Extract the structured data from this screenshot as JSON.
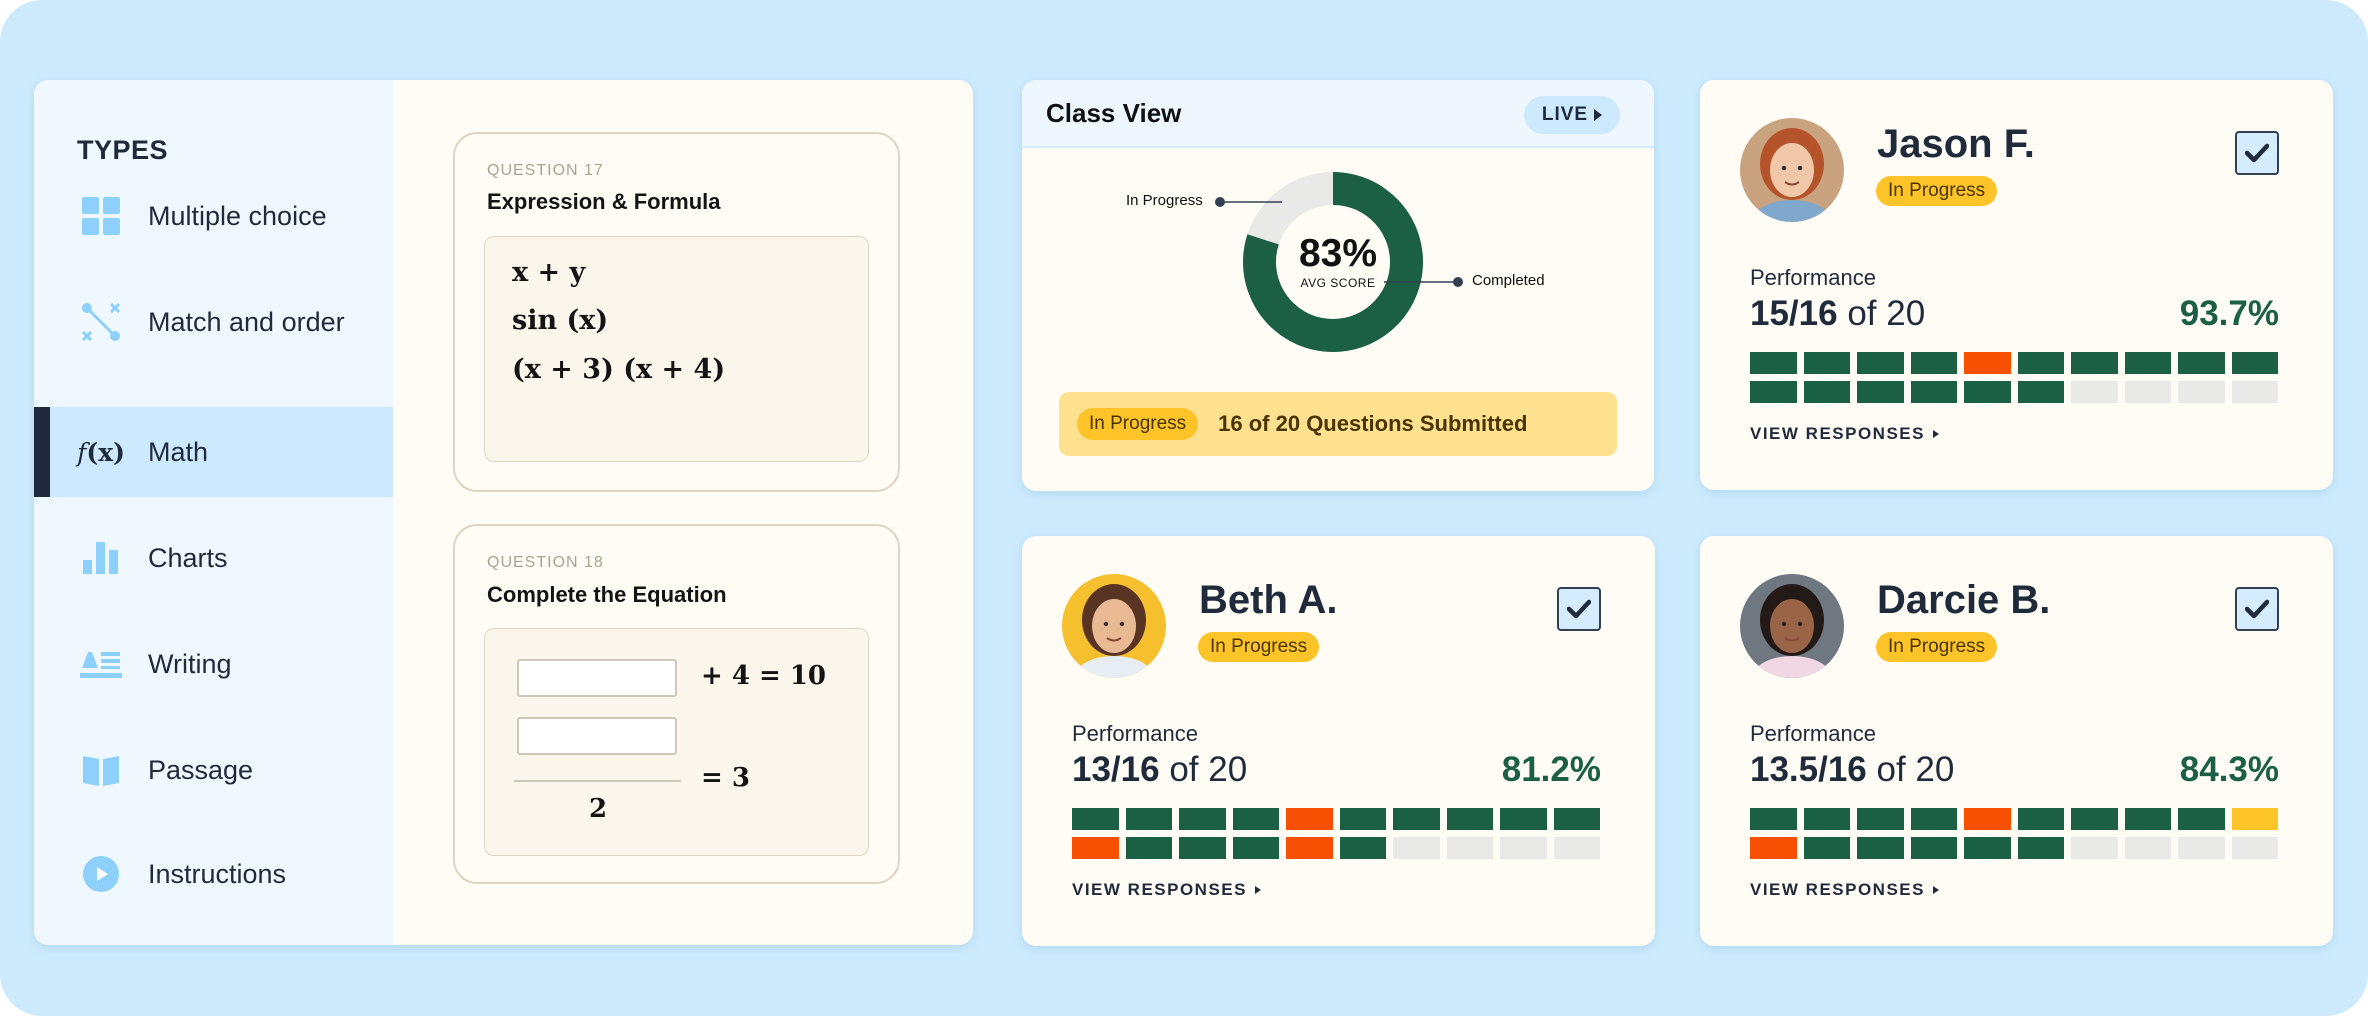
{
  "sidebar": {
    "title": "TYPES",
    "items": [
      {
        "label": "Multiple choice",
        "icon": "grid-icon",
        "active": false
      },
      {
        "label": "Match and order",
        "icon": "match-icon",
        "active": false
      },
      {
        "label": "Math",
        "icon": "fx-icon",
        "active": true
      },
      {
        "label": "Charts",
        "icon": "bar-chart-icon",
        "active": false
      },
      {
        "label": "Writing",
        "icon": "text-icon",
        "active": false
      },
      {
        "label": "Passage",
        "icon": "book-icon",
        "active": false
      },
      {
        "label": "Instructions",
        "icon": "play-icon",
        "active": false
      }
    ],
    "math_icon_f": "f",
    "math_icon_x": "(x)"
  },
  "questions": [
    {
      "number": "QUESTION 17",
      "title": "Expression & Formula",
      "lines": [
        "x + y",
        "sin (x)",
        "(x + 3) (x + 4)"
      ]
    },
    {
      "number": "QUESTION 18",
      "title": "Complete the Equation",
      "eq1_rhs": "+ 4 = 10",
      "eq2_rhs": "= 3",
      "eq2_denominator": "2",
      "input1_value": "",
      "input2_value": ""
    }
  ],
  "class_view": {
    "title": "Class View",
    "live_label": "LIVE",
    "status_pill": "In Progress",
    "status_text": "16 of 20 Questions Submitted",
    "donut": {
      "center_value": "83%",
      "center_label": "AVG SCORE",
      "segments": [
        {
          "name": "Completed",
          "fraction": 0.8,
          "color": "#1b6045"
        },
        {
          "name": "In Progress",
          "fraction": 0.2,
          "color": "#e9e9e7"
        }
      ]
    }
  },
  "students": [
    {
      "name": "Jason F.",
      "status": "In Progress",
      "checked": true,
      "performance_label": "Performance",
      "score": "15/16",
      "of_total": "of 20",
      "percent": "93.7%",
      "avatar_bg": "#c9a27f",
      "hair": "#b5532a",
      "skin": "#f0c7a8",
      "shirt": "#7fa8cc",
      "answers": [
        "c",
        "c",
        "c",
        "c",
        "w",
        "c",
        "c",
        "c",
        "c",
        "c",
        "c",
        "c",
        "c",
        "c",
        "c",
        "c",
        "e",
        "e",
        "e",
        "e"
      ],
      "view_label": "VIEW RESPONSES"
    },
    {
      "name": "Beth A.",
      "status": "In Progress",
      "checked": true,
      "performance_label": "Performance",
      "score": "13/16",
      "of_total": "of 20",
      "percent": "81.2%",
      "avatar_bg": "#f6bf2e",
      "hair": "#5a3422",
      "skin": "#e9b993",
      "shirt": "#e7eef3",
      "answers": [
        "c",
        "c",
        "c",
        "c",
        "w",
        "c",
        "c",
        "c",
        "c",
        "c",
        "w",
        "c",
        "c",
        "c",
        "w",
        "c",
        "e",
        "e",
        "e",
        "e"
      ],
      "view_label": "VIEW RESPONSES"
    },
    {
      "name": "Darcie B.",
      "status": "In Progress",
      "checked": true,
      "performance_label": "Performance",
      "score": "13.5/16",
      "of_total": "of 20",
      "percent": "84.3%",
      "avatar_bg": "#6f7780",
      "hair": "#231916",
      "skin": "#9a6447",
      "shirt": "#f1d6e3",
      "answers": [
        "c",
        "c",
        "c",
        "c",
        "w",
        "c",
        "c",
        "c",
        "c",
        "p",
        "w",
        "c",
        "c",
        "c",
        "c",
        "c",
        "e",
        "e",
        "e",
        "e"
      ],
      "view_label": "VIEW RESPONSES"
    }
  ],
  "colors": {
    "correct": "#1b6045",
    "incorrect": "#f75003",
    "partial": "#fdc42a",
    "unanswered": "#e9e9e7",
    "accent_blue": "#cde9fd"
  }
}
